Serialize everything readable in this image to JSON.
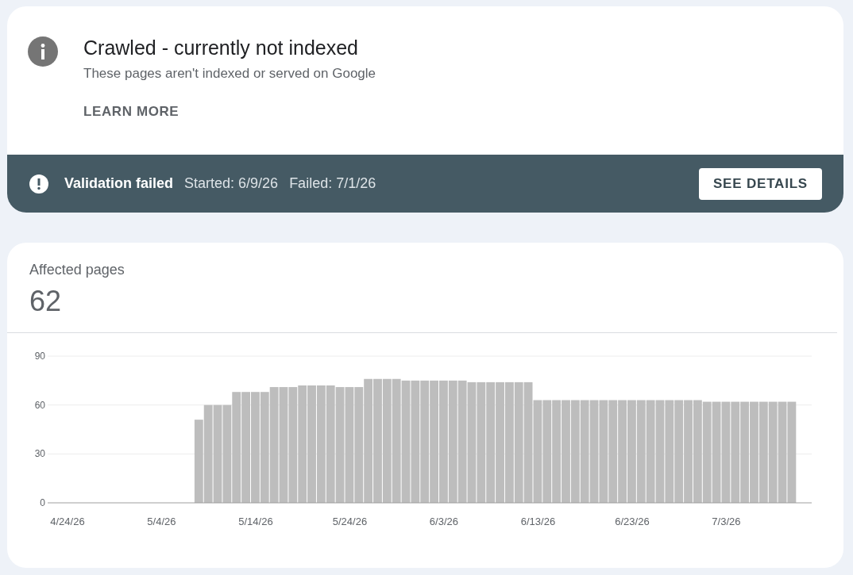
{
  "issue": {
    "title": "Crawled - currently not indexed",
    "description": "These pages aren't indexed or served on Google",
    "link": "LEARN MORE"
  },
  "validation": {
    "status": "Validation failed",
    "started": "Started: 6/9/26",
    "failed": "Failed: 7/1/26",
    "button": "SEE DETAILS"
  },
  "summary": {
    "label": "Affected pages",
    "value": "62",
    "chart_data": {
      "type": "bar",
      "categories": [
        "4/24/26",
        null,
        null,
        null,
        null,
        null,
        null,
        null,
        null,
        null,
        "5/4/26",
        null,
        null,
        null,
        null,
        null,
        null,
        null,
        null,
        null,
        "5/14/26",
        null,
        null,
        null,
        null,
        null,
        null,
        null,
        null,
        null,
        "5/24/26",
        null,
        null,
        null,
        null,
        null,
        null,
        null,
        null,
        null,
        "6/3/26",
        null,
        null,
        null,
        null,
        null,
        null,
        null,
        null,
        null,
        "6/13/26",
        null,
        null,
        null,
        null,
        null,
        null,
        null,
        null,
        null,
        "6/23/26",
        null,
        null,
        null,
        null,
        null,
        null,
        null,
        null,
        null,
        "7/3/26",
        null,
        null,
        null,
        null,
        null,
        null,
        null
      ],
      "series": [
        {
          "color": "#bdbdbd",
          "values": [
            null,
            null,
            null,
            null,
            null,
            null,
            null,
            null,
            null,
            null,
            null,
            null,
            null,
            null,
            51,
            60,
            60,
            60,
            68,
            68,
            68,
            68,
            71,
            71,
            71,
            72,
            72,
            72,
            72,
            71,
            71,
            71,
            76,
            76,
            76,
            76,
            75,
            75,
            75,
            75,
            75,
            75,
            75,
            74,
            74,
            74,
            74,
            74,
            74,
            74,
            63,
            63,
            63,
            63,
            63,
            63,
            63,
            63,
            63,
            63,
            63,
            63,
            63,
            63,
            63,
            63,
            63,
            63,
            62,
            62,
            62,
            62,
            62,
            62,
            62,
            62,
            62,
            62
          ]
        }
      ],
      "ylim": [
        0,
        90
      ],
      "yticks": [
        0,
        30,
        60,
        90
      ]
    }
  }
}
